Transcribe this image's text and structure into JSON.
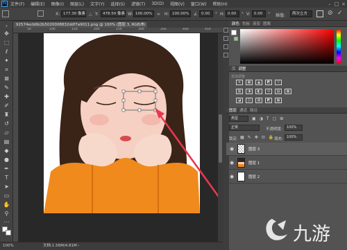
{
  "menubar": {
    "logo": "Ps",
    "items": [
      "文件(F)",
      "编辑(E)",
      "图像(I)",
      "图层(L)",
      "文字(Y)",
      "选择(S)",
      "滤镜(T)",
      "3D(D)",
      "视图(V)",
      "窗口(W)",
      "帮助(H)"
    ]
  },
  "options": {
    "x_label": "X:",
    "x_value": "177.30 像素",
    "y_label": "Y:",
    "y_value": "478.50 像素",
    "w_label": "W:",
    "w_value": "100.00%",
    "h_label": "H:",
    "h_value": "100.00%",
    "angle_value": "0.00",
    "h2_label": "H:",
    "h2_value": "0.00",
    "v_label": "V:",
    "v_value": "0.00",
    "interp_label": "插值:",
    "interp_value": "两次立方"
  },
  "document": {
    "tab_title": "92574ecb6b2b5020008832ddf7a9011.png @ 100% (图层 3, RGB/8)",
    "ruler_marks": [
      "50",
      "100",
      "150",
      "200",
      "250",
      "300",
      "350",
      "400",
      "450"
    ]
  },
  "status": {
    "zoom": "100%",
    "doc_info": "文档:1.56M/4.81M"
  },
  "panels": {
    "color_tabs": [
      "颜色",
      "色板",
      "渐变",
      "图案"
    ],
    "adjust_tabs": [
      "库",
      "调整"
    ],
    "adjust_header": "添加调整",
    "adjust_row1": [
      "☀",
      "▦",
      "▲",
      "◩",
      "▽"
    ],
    "adjust_row2": [
      "▥",
      "◑",
      "◧",
      "⊙",
      "▤",
      "▦"
    ],
    "adjust_row3": [
      "◪",
      "◫",
      "▨",
      "◩",
      "▦"
    ],
    "layers_tabs": [
      "图层",
      "通道",
      "路径"
    ],
    "kind_label": "类型",
    "blend_mode": "正常",
    "opacity_label": "不透明度:",
    "opacity_value": "100%",
    "lock_label": "锁定:",
    "fill_label": "填充:",
    "fill_value": "100%",
    "layers": [
      {
        "name": "图层 3",
        "selected": true
      },
      {
        "name": "图层 1",
        "selected": false
      },
      {
        "name": "图层 2",
        "selected": false
      }
    ]
  },
  "colors": {
    "accent": "#31a8ff",
    "arrow": "#e8384f",
    "sweater": "#f08a1c",
    "hair": "#3a2418"
  },
  "watermark": {
    "text": "九游"
  }
}
